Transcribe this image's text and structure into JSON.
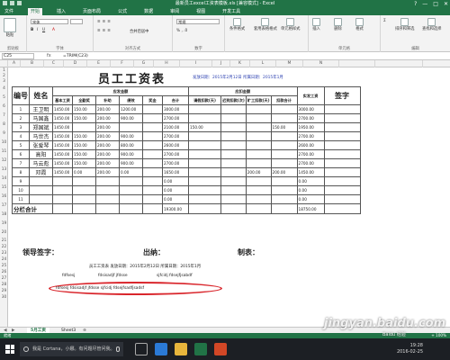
{
  "window": {
    "title": "最新员工excel工资表模板.xls [兼容模式] - Excel",
    "controls": [
      "?",
      "—",
      "□",
      "✕"
    ]
  },
  "ribbon_tabs": [
    "文件",
    "开始",
    "插入",
    "页面布局",
    "公式",
    "数据",
    "审阅",
    "视图",
    "开发工具"
  ],
  "ribbon": {
    "paste_label": "粘贴",
    "clipboard_label": "剪贴板",
    "font_name": "宋体",
    "font_label": "字体",
    "align_label": "对齐方式",
    "merge_label": "合并后居中",
    "number_format": "常规",
    "number_label": "数字",
    "cond_format": "条件格式",
    "table_format": "套用表格格式",
    "cell_style": "单元格样式",
    "insert": "插入",
    "delete": "删除",
    "format": "格式",
    "cells_label": "单元格",
    "sort_filter": "排序和筛选",
    "find_select": "查找和选择",
    "edit_label": "编辑"
  },
  "formula_bar": {
    "name_box": "C25",
    "fx": "fx",
    "formula": "=TRIM(C23)"
  },
  "columns": [
    "A",
    "B",
    "C",
    "D",
    "E",
    "F",
    "G",
    "H",
    "I",
    "J",
    "K",
    "L",
    "M",
    "N"
  ],
  "rows": [
    "1",
    "2",
    "3",
    "4",
    "5",
    "6",
    "7",
    "8",
    "9",
    "10",
    "11",
    "12",
    "13",
    "14",
    "15",
    "16",
    "17",
    "18",
    "19",
    "20",
    "21",
    "22",
    "23",
    "24",
    "25",
    "26",
    "27",
    "28",
    "29",
    "30"
  ],
  "sheet": {
    "title": "员工工资表",
    "date_line": "发放日期：2015年2月12日 所属日期：2015年1月",
    "headers": {
      "no": "编号",
      "name": "姓名",
      "payable": "应发金额",
      "deduct": "应扣金额",
      "base": "基本工资",
      "allow": "全勤奖",
      "subsidy": "补助",
      "bonus": "绩效",
      "prize": "奖金",
      "total": "合计",
      "leave": "请假扣款(天)",
      "late": "迟到扣款(次)",
      "absent": "旷工扣款(天)",
      "deduct_total": "扣款合计",
      "net": "实发工资",
      "signature": "签字"
    },
    "employees": [
      {
        "no": "1",
        "name": "王卫明",
        "base": "1450.00",
        "allow": "150.00",
        "subsidy": "200.00",
        "bonus": "1200.00",
        "total": "3000.00",
        "net": "3000.00"
      },
      {
        "no": "2",
        "name": "马国鑫",
        "base": "1450.00",
        "allow": "150.00",
        "subsidy": "200.00",
        "bonus": "900.00",
        "total": "2700.00",
        "net": "2700.00"
      },
      {
        "no": "3",
        "name": "郑国斌",
        "base": "1450.00",
        "allow": "",
        "subsidy": "200.00",
        "bonus": "",
        "total": "2100.00",
        "leave": "150.00",
        "dtotal": "150.00",
        "net": "1950.00"
      },
      {
        "no": "4",
        "name": "马世杰",
        "base": "1450.00",
        "allow": "150.00",
        "subsidy": "200.00",
        "bonus": "900.00",
        "total": "2700.00",
        "net": "2700.00"
      },
      {
        "no": "5",
        "name": "张爱琴",
        "base": "1450.00",
        "allow": "150.00",
        "subsidy": "200.00",
        "bonus": "800.00",
        "total": "2600.00",
        "net": "2600.00"
      },
      {
        "no": "6",
        "name": "高阳",
        "base": "1450.00",
        "allow": "150.00",
        "subsidy": "200.00",
        "bonus": "900.00",
        "total": "2700.00",
        "net": "2700.00"
      },
      {
        "no": "7",
        "name": "马云彪",
        "base": "1450.00",
        "allow": "150.00",
        "subsidy": "200.00",
        "bonus": "900.00",
        "total": "2700.00",
        "net": "2700.00"
      },
      {
        "no": "8",
        "name": "邓霞",
        "base": "1450.00",
        "allow": "0.00",
        "subsidy": "200.00",
        "bonus": "0.00",
        "total": "1650.00",
        "absent": "200.00",
        "dtotal": "200.00",
        "net": "1450.00"
      },
      {
        "no": "9",
        "name": "",
        "total": "0.00",
        "net": "0.00"
      },
      {
        "no": "10",
        "name": "",
        "total": "0.00",
        "net": "0.00"
      },
      {
        "no": "11",
        "name": "",
        "total": "0.00",
        "net": "0.00"
      }
    ],
    "subtotal_label": "分栏合计",
    "subtotal_total": "19300.00",
    "subtotal_net": "18750.00",
    "leader_sign": "领导签字：",
    "cashier": "出纳：",
    "preparer": "制表：",
    "concat_line": "员工工资表 发放日期：2015年2月12日 所属日期：2015年1月",
    "left_fragment": "fdfsesj",
    "mid_fragment": "fdsisadjf jfdsse",
    "right_fragment": "sjfcidj fdsejfjsabdf",
    "trim_result": "fdfsesj fdsisadjf jfdsse sjfcidj fdsejfsadfjsadsf"
  },
  "sheet_tabs": {
    "nav": "◀ ▶",
    "tabs": [
      "5月工资",
      "Sheet3"
    ],
    "add": "⊕"
  },
  "status": {
    "left": "就绪",
    "right": "+  100%"
  },
  "taskbar": {
    "search_placeholder": "我是 Cortana，小娜。有问题尽管问我。",
    "time": "19:28",
    "date": "2016-02-25"
  },
  "watermark": {
    "text": "jingyan.baidu.com",
    "sub": "Baidu 经验"
  },
  "colors": {
    "excel_green": "#217346",
    "highlight_red": "#d9262c",
    "taskbar": "#1c1f24"
  }
}
